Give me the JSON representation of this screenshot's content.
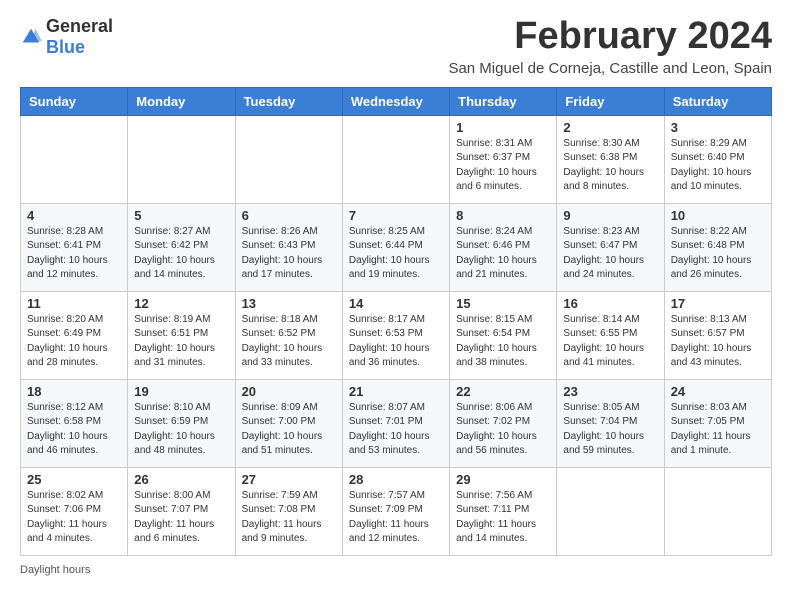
{
  "header": {
    "title": "February 2024",
    "subtitle": "San Miguel de Corneja, Castille and Leon, Spain",
    "logo_general": "General",
    "logo_blue": "Blue"
  },
  "days_of_week": [
    "Sunday",
    "Monday",
    "Tuesday",
    "Wednesday",
    "Thursday",
    "Friday",
    "Saturday"
  ],
  "footer": {
    "note": "Daylight hours"
  },
  "weeks": [
    [
      {
        "day": "",
        "info": ""
      },
      {
        "day": "",
        "info": ""
      },
      {
        "day": "",
        "info": ""
      },
      {
        "day": "",
        "info": ""
      },
      {
        "day": "1",
        "info": "Sunrise: 8:31 AM\nSunset: 6:37 PM\nDaylight: 10 hours and 6 minutes."
      },
      {
        "day": "2",
        "info": "Sunrise: 8:30 AM\nSunset: 6:38 PM\nDaylight: 10 hours and 8 minutes."
      },
      {
        "day": "3",
        "info": "Sunrise: 8:29 AM\nSunset: 6:40 PM\nDaylight: 10 hours and 10 minutes."
      }
    ],
    [
      {
        "day": "4",
        "info": "Sunrise: 8:28 AM\nSunset: 6:41 PM\nDaylight: 10 hours and 12 minutes."
      },
      {
        "day": "5",
        "info": "Sunrise: 8:27 AM\nSunset: 6:42 PM\nDaylight: 10 hours and 14 minutes."
      },
      {
        "day": "6",
        "info": "Sunrise: 8:26 AM\nSunset: 6:43 PM\nDaylight: 10 hours and 17 minutes."
      },
      {
        "day": "7",
        "info": "Sunrise: 8:25 AM\nSunset: 6:44 PM\nDaylight: 10 hours and 19 minutes."
      },
      {
        "day": "8",
        "info": "Sunrise: 8:24 AM\nSunset: 6:46 PM\nDaylight: 10 hours and 21 minutes."
      },
      {
        "day": "9",
        "info": "Sunrise: 8:23 AM\nSunset: 6:47 PM\nDaylight: 10 hours and 24 minutes."
      },
      {
        "day": "10",
        "info": "Sunrise: 8:22 AM\nSunset: 6:48 PM\nDaylight: 10 hours and 26 minutes."
      }
    ],
    [
      {
        "day": "11",
        "info": "Sunrise: 8:20 AM\nSunset: 6:49 PM\nDaylight: 10 hours and 28 minutes."
      },
      {
        "day": "12",
        "info": "Sunrise: 8:19 AM\nSunset: 6:51 PM\nDaylight: 10 hours and 31 minutes."
      },
      {
        "day": "13",
        "info": "Sunrise: 8:18 AM\nSunset: 6:52 PM\nDaylight: 10 hours and 33 minutes."
      },
      {
        "day": "14",
        "info": "Sunrise: 8:17 AM\nSunset: 6:53 PM\nDaylight: 10 hours and 36 minutes."
      },
      {
        "day": "15",
        "info": "Sunrise: 8:15 AM\nSunset: 6:54 PM\nDaylight: 10 hours and 38 minutes."
      },
      {
        "day": "16",
        "info": "Sunrise: 8:14 AM\nSunset: 6:55 PM\nDaylight: 10 hours and 41 minutes."
      },
      {
        "day": "17",
        "info": "Sunrise: 8:13 AM\nSunset: 6:57 PM\nDaylight: 10 hours and 43 minutes."
      }
    ],
    [
      {
        "day": "18",
        "info": "Sunrise: 8:12 AM\nSunset: 6:58 PM\nDaylight: 10 hours and 46 minutes."
      },
      {
        "day": "19",
        "info": "Sunrise: 8:10 AM\nSunset: 6:59 PM\nDaylight: 10 hours and 48 minutes."
      },
      {
        "day": "20",
        "info": "Sunrise: 8:09 AM\nSunset: 7:00 PM\nDaylight: 10 hours and 51 minutes."
      },
      {
        "day": "21",
        "info": "Sunrise: 8:07 AM\nSunset: 7:01 PM\nDaylight: 10 hours and 53 minutes."
      },
      {
        "day": "22",
        "info": "Sunrise: 8:06 AM\nSunset: 7:02 PM\nDaylight: 10 hours and 56 minutes."
      },
      {
        "day": "23",
        "info": "Sunrise: 8:05 AM\nSunset: 7:04 PM\nDaylight: 10 hours and 59 minutes."
      },
      {
        "day": "24",
        "info": "Sunrise: 8:03 AM\nSunset: 7:05 PM\nDaylight: 11 hours and 1 minute."
      }
    ],
    [
      {
        "day": "25",
        "info": "Sunrise: 8:02 AM\nSunset: 7:06 PM\nDaylight: 11 hours and 4 minutes."
      },
      {
        "day": "26",
        "info": "Sunrise: 8:00 AM\nSunset: 7:07 PM\nDaylight: 11 hours and 6 minutes."
      },
      {
        "day": "27",
        "info": "Sunrise: 7:59 AM\nSunset: 7:08 PM\nDaylight: 11 hours and 9 minutes."
      },
      {
        "day": "28",
        "info": "Sunrise: 7:57 AM\nSunset: 7:09 PM\nDaylight: 11 hours and 12 minutes."
      },
      {
        "day": "29",
        "info": "Sunrise: 7:56 AM\nSunset: 7:11 PM\nDaylight: 11 hours and 14 minutes."
      },
      {
        "day": "",
        "info": ""
      },
      {
        "day": "",
        "info": ""
      }
    ]
  ]
}
